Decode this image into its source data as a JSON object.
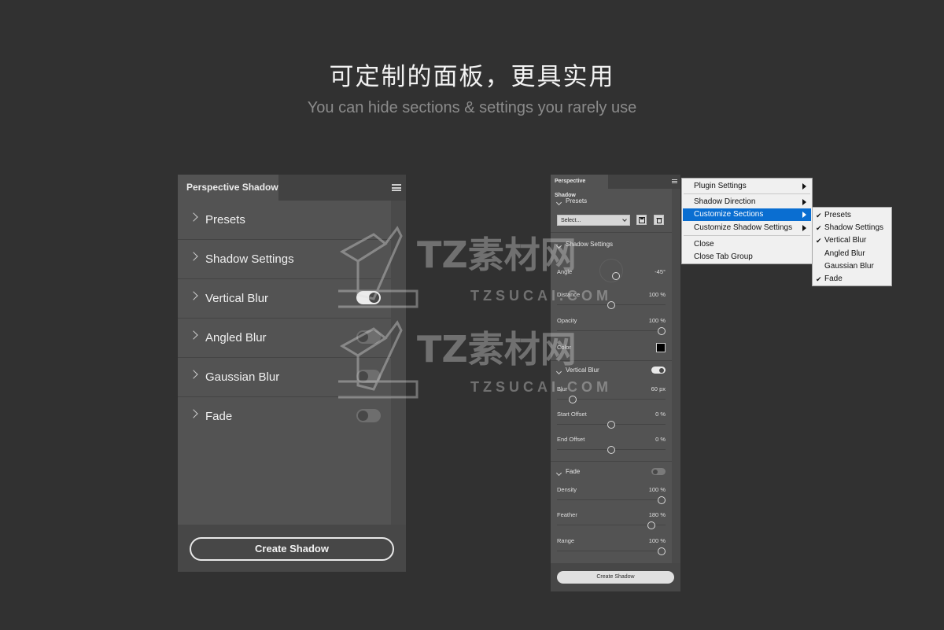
{
  "header": {
    "title": "可定制的面板，更具实用",
    "subtitle": "You can hide sections & settings you rarely use"
  },
  "panel_large": {
    "tab_title": "Perspective Shadow",
    "rows": [
      {
        "label": "Presets",
        "toggle": null
      },
      {
        "label": "Shadow Settings",
        "toggle": null
      },
      {
        "label": "Vertical Blur",
        "toggle": "on"
      },
      {
        "label": "Angled Blur",
        "toggle": "off"
      },
      {
        "label": "Gaussian Blur",
        "toggle": "off"
      },
      {
        "label": "Fade",
        "toggle": "off"
      }
    ],
    "button": "Create Shadow"
  },
  "panel_small": {
    "tab_title": "Perspective Shadow",
    "presets": {
      "title": "Presets",
      "select_value": "Select...",
      "save_icon": "save-icon",
      "delete_icon": "trash-icon"
    },
    "shadow_settings": {
      "title": "Shadow Settings",
      "angle": {
        "label": "Angle",
        "value": "-45°"
      },
      "distance": {
        "label": "Distance",
        "value": "100 %"
      },
      "opacity": {
        "label": "Opacity",
        "value": "100 %"
      },
      "color": {
        "label": "Color",
        "swatch": "#000000"
      }
    },
    "vertical_blur": {
      "title": "Vertical Blur",
      "enabled": true,
      "blur": {
        "label": "Blur",
        "value": "60 px"
      },
      "start_offset": {
        "label": "Start Offset",
        "value": "0 %"
      },
      "end_offset": {
        "label": "End Offset",
        "value": "0 %"
      }
    },
    "fade": {
      "title": "Fade",
      "enabled": false,
      "density": {
        "label": "Density",
        "value": "100 %"
      },
      "feather": {
        "label": "Feather",
        "value": "180 %"
      },
      "range": {
        "label": "Range",
        "value": "100 %"
      }
    },
    "button": "Create Shadow"
  },
  "context_menu": {
    "items": [
      {
        "label": "Plugin Settings",
        "submenu": true
      },
      {
        "label": "Shadow Direction",
        "submenu": true
      },
      {
        "label": "Customize Sections",
        "submenu": true,
        "highlighted": true
      },
      {
        "label": "Customize Shadow Settings",
        "submenu": true
      },
      {
        "label": "Close",
        "submenu": false
      },
      {
        "label": "Close Tab Group",
        "submenu": false
      }
    ]
  },
  "submenu": {
    "items": [
      {
        "label": "Presets",
        "checked": true
      },
      {
        "label": "Shadow Settings",
        "checked": true
      },
      {
        "label": "Vertical Blur",
        "checked": true
      },
      {
        "label": "Angled Blur",
        "checked": false
      },
      {
        "label": "Gaussian Blur",
        "checked": false
      },
      {
        "label": "Fade",
        "checked": true
      }
    ]
  },
  "watermark": {
    "brand_cn": "TZ素材网",
    "brand_en": "TZSUCAI.COM"
  },
  "colors": {
    "background": "#313131",
    "panel": "#535353",
    "menu_highlight": "#0a6ed1"
  }
}
